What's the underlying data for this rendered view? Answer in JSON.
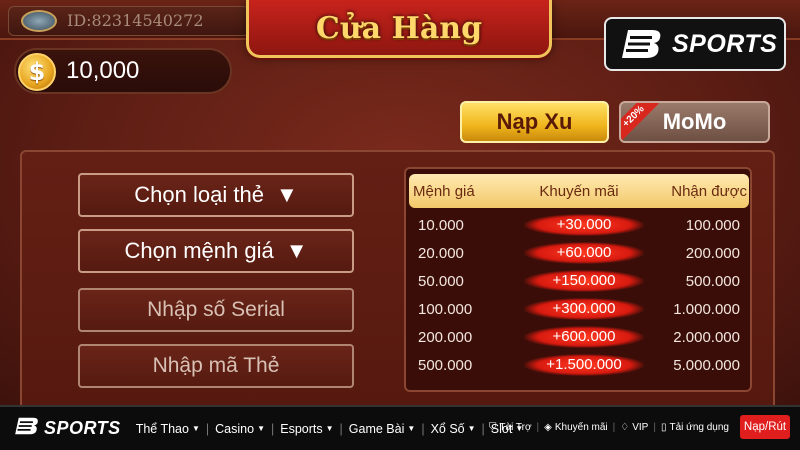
{
  "header": {
    "player_id": "ID:82314540272",
    "title": "Cửa Hàng",
    "brand": "SPORTS"
  },
  "wallet": {
    "coin_icon": "$",
    "balance": "10,000"
  },
  "tabs": {
    "napxu_label": "Nạp Xu",
    "momo_label": "MoMo",
    "momo_badge": "+20%"
  },
  "form": {
    "card_type_label": "Chọn loại thẻ",
    "card_value_label": "Chọn mệnh giá",
    "dropdown_arrow": "▼",
    "serial_placeholder": "Nhập số Serial",
    "code_placeholder": "Nhập mã Thẻ"
  },
  "rate_table": {
    "headers": [
      "Mệnh giá",
      "Khuyến mãi",
      "Nhận được"
    ],
    "rows": [
      [
        "10.000",
        "+30.000",
        "100.000"
      ],
      [
        "20.000",
        "+60.000",
        "200.000"
      ],
      [
        "50.000",
        "+150.000",
        "500.000"
      ],
      [
        "100.000",
        "+300.000",
        "1.000.000"
      ],
      [
        "200.000",
        "+600.000",
        "2.000.000"
      ],
      [
        "500.000",
        "+1.500.000",
        "5.000.000"
      ]
    ]
  },
  "footer": {
    "brand": "SPORTS",
    "nav": [
      "Thể Thao",
      "Casino",
      "Esports",
      "Game Bài",
      "Xổ Số",
      "Slot"
    ],
    "links": [
      {
        "icon": "handshake-icon",
        "glyph": "⛉",
        "label": "Tài Trợ"
      },
      {
        "icon": "tag-icon",
        "glyph": "◈",
        "label": "Khuyến mãi"
      },
      {
        "icon": "diamond-icon",
        "glyph": "♢",
        "label": "VIP"
      },
      {
        "icon": "phone-icon",
        "glyph": "▯",
        "label": "Tải ứng dụng"
      }
    ],
    "deposit_button": "Nạp/Rút"
  },
  "colors": {
    "accent_gold": "#f0b51c",
    "banner_red": "#c7231c",
    "promo_red": "#d81a10",
    "deposit_red": "#e01e1e"
  }
}
